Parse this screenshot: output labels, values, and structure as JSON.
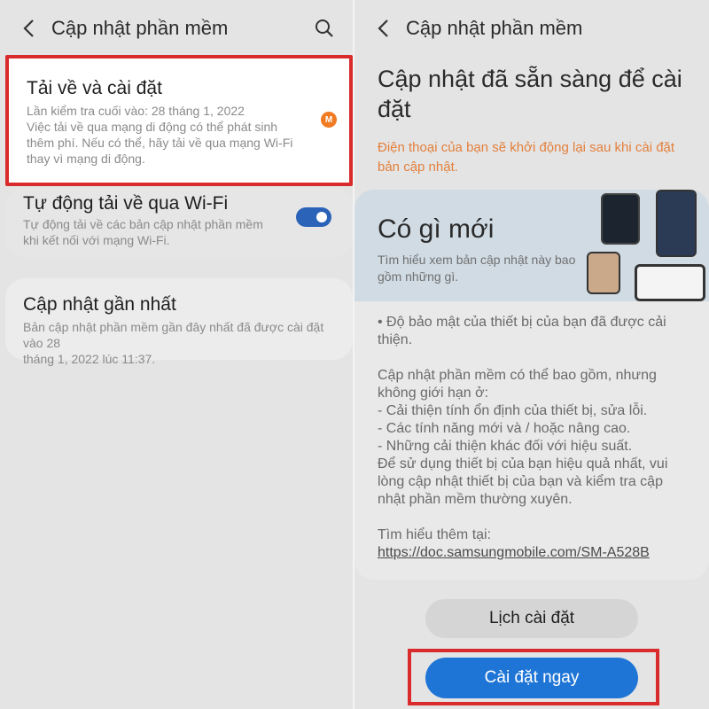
{
  "left": {
    "header": {
      "title": "Cập nhật phần mềm"
    },
    "download_card": {
      "title": "Tải về và cài đặt",
      "desc_lines": [
        "Lần kiểm tra cuối vào: 28 tháng 1, 2022",
        "Việc tải về qua mạng di động có thể phát sinh",
        "thêm phí. Nếu có thể, hãy tải về qua mạng Wi-Fi",
        "thay vì mạng di động."
      ],
      "badge": "M"
    },
    "wifi_card": {
      "title": "Tự động tải về qua Wi-Fi",
      "desc_lines": [
        "Tự động tải về các bản cập nhật phần mềm",
        "khi kết nối với mạng Wi-Fi."
      ],
      "toggle_on": true
    },
    "last_update_card": {
      "title": "Cập nhật gần nhất",
      "desc_lines": [
        "Bản cập nhật phần mềm gần đây nhất đã được cài đặt vào 28",
        "tháng 1, 2022 lúc 11:37."
      ]
    }
  },
  "right": {
    "header": {
      "title": "Cập nhật phần mềm"
    },
    "title": "Cập nhật đã sẵn sàng để cài đặt",
    "warning": "Điện thoại của bạn sẽ khởi động lại sau khi cài đặt bản cập nhật.",
    "whats_new": {
      "title": "Có gì mới",
      "subtitle": "Tìm hiểu xem bản cập nhật này bao gồm những gì.",
      "security": "• Độ bảo mật của thiết bị của bạn đã được cải thiện.",
      "body_lines": [
        "Cập nhật phần mềm có thể bao gồm, nhưng",
        "không giới hạn ở:",
        " - Cải thiện tính ổn định của thiết bị, sửa lỗi.",
        " - Các tính năng mới và / hoặc nâng cao.",
        " - Những cải thiện khác đối với hiệu suất.",
        "Để sử dụng thiết bị của bạn hiệu quả nhất, vui",
        "lòng cập nhật thiết bị của bạn và kiểm tra cập",
        "nhật phần mềm thường xuyên."
      ],
      "more_label": "Tìm hiểu thêm tại:",
      "more_link": "https://doc.samsungmobile.com/SM-A528B"
    },
    "schedule_button": "Lịch cài đặt",
    "install_button": "Cài đặt ngay"
  },
  "colors": {
    "accent": "#1f75d6",
    "highlight_border": "#d92b2b",
    "warning": "#e37f3b",
    "badge": "#f07b22"
  }
}
